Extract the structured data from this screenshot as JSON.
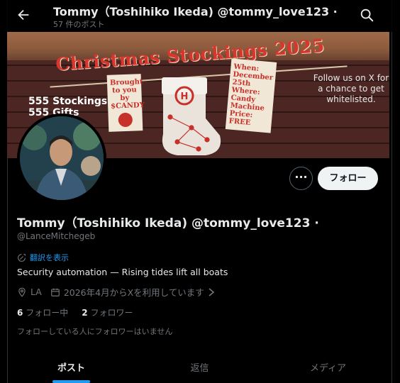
{
  "header": {
    "title": "Tommy（Toshihiko Ikeda) @tommy_love123 ·",
    "post_count": "57 件のポスト"
  },
  "banner": {
    "title": "Christmas Stockings 2025",
    "counts": [
      "555 Stockings",
      "555 Gifts"
    ],
    "tag_left": "Brought to you by $CANDY",
    "tag_right": [
      "When:",
      "December 25th",
      "Where:",
      "Candy Machine",
      "Price:",
      "FREE"
    ],
    "note": "Follow us on X for a chance to get whitelisted.",
    "colors": {
      "title": "#d8352c",
      "wall": "#4b2622",
      "wood": "#8c5b3d"
    }
  },
  "actions": {
    "more_label": "···",
    "follow_label": "フォロー"
  },
  "profile": {
    "name": "Tommy（Toshihiko Ikeda) @tommy_love123 ·",
    "handle": "@LanceMitchegeb",
    "translate": "翻訳を表示",
    "bio": "Security automation — Rising tides lift all boats",
    "location": "LA",
    "joined": "2026年4月からXを利用しています",
    "following_count": "6",
    "following_label": "フォロー中",
    "followers_count": "2",
    "followers_label": "フォロワー",
    "notice": "フォローしている人にフォロワーはいません"
  },
  "tabs": [
    {
      "label": "ポスト",
      "active": true
    },
    {
      "label": "返信",
      "active": false
    },
    {
      "label": "メディア",
      "active": false
    }
  ],
  "colors": {
    "accent": "#1d9bf0",
    "background": "#000000",
    "muted": "#71767b"
  }
}
